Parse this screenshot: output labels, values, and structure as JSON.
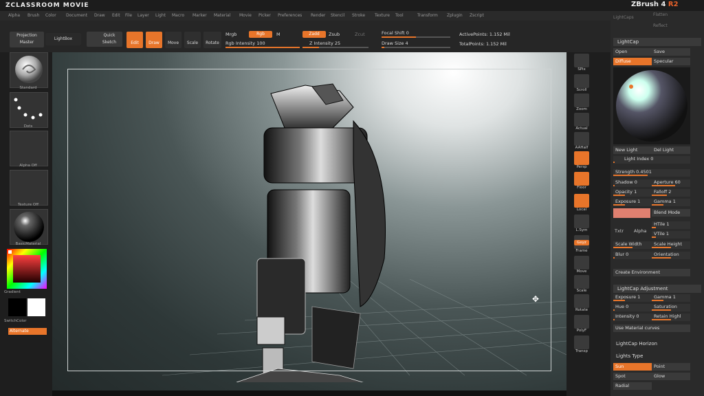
{
  "app_title": "ZCLASSROOM MOVIE",
  "brand": {
    "name": "ZBrush 4",
    "version": "R2"
  },
  "menu": [
    "Alpha",
    "Brush",
    "Color",
    "Document",
    "Draw",
    "Edit",
    "File",
    "Layer",
    "Light",
    "Macro",
    "Marker",
    "Material",
    "Movie",
    "Picker",
    "Preferences",
    "Render",
    "Stencil",
    "Stroke",
    "Texture",
    "Tool",
    "Transform",
    "Zplugin",
    "Zscript"
  ],
  "toolbar": {
    "projection_master": "Projection Master",
    "lightbox": "LightBox",
    "quick_sketch": "Quick Sketch",
    "edit": "Edit",
    "draw": "Draw",
    "move": "Move",
    "scale": "Scale",
    "rotate": "Rotate",
    "mrgb": "Mrgb",
    "rgb": "Rgb",
    "m": "M",
    "rgb_intensity": "Rgb Intensity 100",
    "zadd": "Zadd",
    "zsub": "Zsub",
    "zcut": "Zcut",
    "z_intensity": "Z Intensity 25",
    "focal_shift": "Focal Shift 0",
    "draw_size": "Draw Size 4",
    "active_points": "ActivePoints: 1.152 Mil",
    "total_points": "TotalPoints: 1.152 Mil"
  },
  "left_shelf": {
    "standard": "Standard",
    "dots": "Dots",
    "alpha_off": "Alpha Off",
    "texture_off": "Texture Off",
    "material": "BasicMaterial",
    "gradient": "Gradient",
    "switchcolor": "SwitchColor",
    "alternate": "Alternate"
  },
  "right_shelf": [
    "SPix",
    "Scroll",
    "Zoom",
    "Actual",
    "AAHalf",
    "Persp",
    "Floor",
    "Local",
    "L.Sym",
    "Frame",
    "Move",
    "Scale",
    "Rotate",
    "PolyF",
    "Transp"
  ],
  "right_shelf_xyz": "Gxyz",
  "tray": {
    "top_items": [
      "LightCaps",
      "Flatten",
      "Reflect"
    ],
    "lightcap_title": "LightCap",
    "open": "Open",
    "save": "Save",
    "diffuse": "Diffuse",
    "specular": "Specular",
    "new_light": "New Light",
    "del_light": "Del Light",
    "light_index": "Light Index 0",
    "strength": "Strength 0.4501",
    "shadow": "Shadow 0",
    "aperture": "Aperture 60",
    "opacity": "Opacity 1",
    "falloff": "Falloff 2",
    "exposure": "Exposure 1",
    "gamma": "Gamma 1",
    "blend_mode": "Blend Mode",
    "txtr": "Txtr",
    "alpha": "Alpha",
    "hthe": "HTile 1",
    "vtile": "VTile 1",
    "scale_width": "Scale Width",
    "scale_height": "Scale Height",
    "blur": "Blur 0",
    "orientation": "Orientation",
    "create_env": "Create Environment",
    "adjust_title": "LightCap Adjustment",
    "adj_exposure": "Exposure 1",
    "adj_gamma": "Gamma 1",
    "hue": "Hue 0",
    "saturation": "Saturation",
    "intensity": "Intensity 0",
    "retain": "Retain Highl",
    "use_material": "Use Material curves",
    "horizon": "LightCap Horizon",
    "lights_type": "Lights Type",
    "sun": "Sun",
    "point": "Point",
    "spot": "Spot",
    "glow": "Glow",
    "radial": "Radial"
  },
  "colors": {
    "accent": "#e8752a",
    "panel": "#2a2a2a"
  }
}
